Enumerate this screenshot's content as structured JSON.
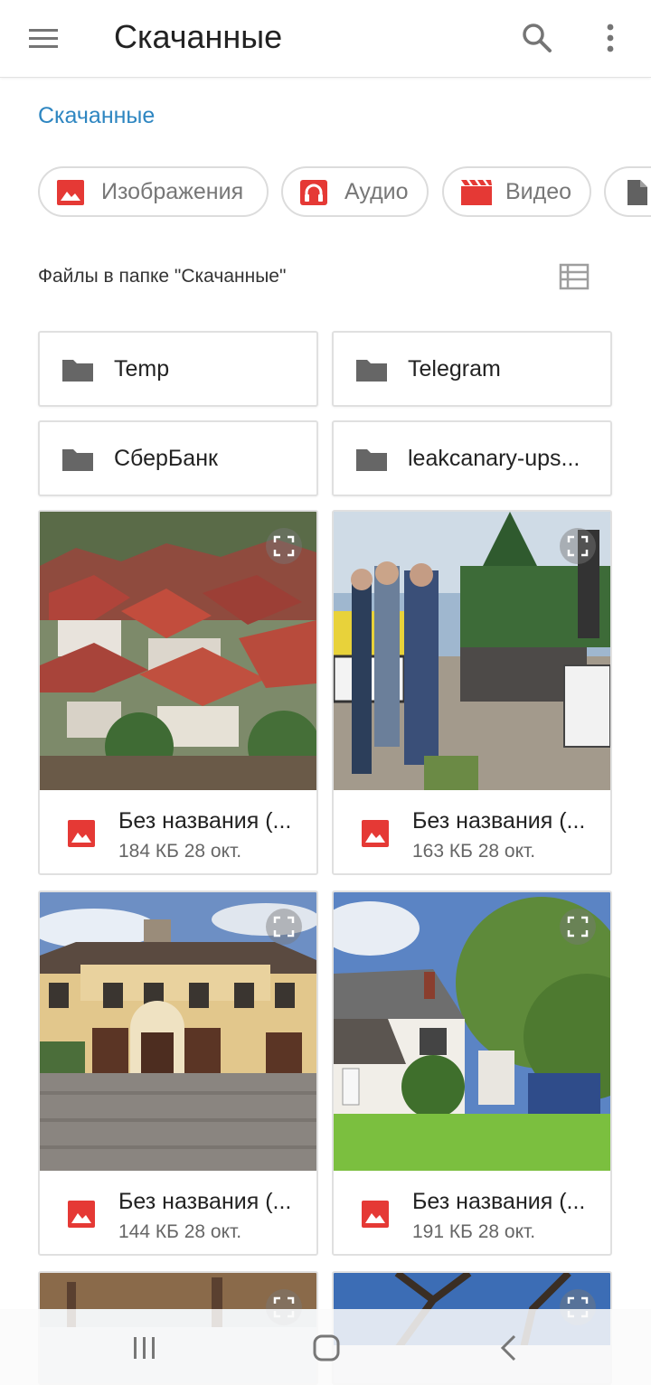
{
  "appbar": {
    "title": "Скачанные",
    "menu_icon": "hamburger-menu-icon",
    "search_icon": "search-icon",
    "more_icon": "more-vertical-icon"
  },
  "breadcrumb": "Скачанные",
  "categories": [
    {
      "label": "Изображения",
      "icon": "image-icon",
      "color": "#e53935"
    },
    {
      "label": "Аудио",
      "icon": "headphones-icon",
      "color": "#e53935"
    },
    {
      "label": "Видео",
      "icon": "video-clapper-icon",
      "color": "#e53935"
    },
    {
      "label": "",
      "icon": "document-icon",
      "color": "#616161"
    }
  ],
  "section": {
    "label": "Файлы в папке \"Скачанные\"",
    "view_icon": "list-view-icon"
  },
  "folders": [
    {
      "name": "Temp"
    },
    {
      "name": "Telegram"
    },
    {
      "name": "СберБанк"
    },
    {
      "name": "leakcanary-ups..."
    }
  ],
  "files": [
    {
      "name": "Без названия (...",
      "meta": "184 КБ 28 окт."
    },
    {
      "name": "Без названия (...",
      "meta": "163 КБ 28 окт."
    },
    {
      "name": "Без названия (...",
      "meta": "144 КБ 28 окт."
    },
    {
      "name": "Без названия (...",
      "meta": "191 КБ 28 окт."
    }
  ],
  "colors": {
    "accent": "#2e86c1",
    "file_icon": "#e53935",
    "folder_icon": "#666666"
  },
  "navbar": {
    "recents_icon": "recent-apps-icon",
    "home_icon": "home-icon",
    "back_icon": "back-icon"
  }
}
